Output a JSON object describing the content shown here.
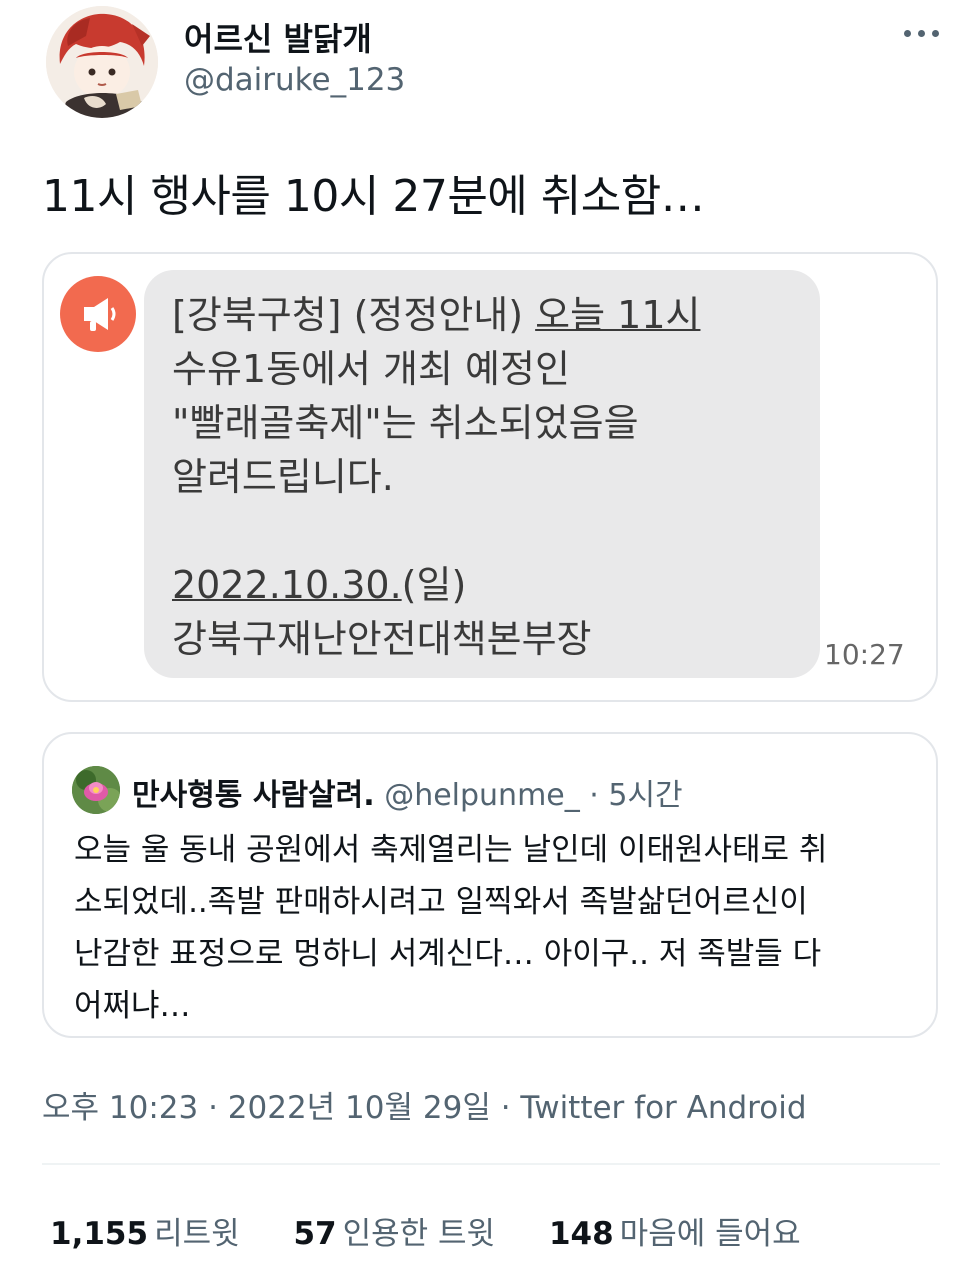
{
  "author": {
    "display_name": "어르신 발닭개",
    "handle": "@dairuke_123"
  },
  "tweet": {
    "text": "11시 행사를 10시 27분에 취소함…",
    "meta": "오후 10:23 · 2022년 10월 29일 · Twitter for Android"
  },
  "sms": {
    "line1_pre": "[강북구청] (정정안내) ",
    "line1_link": "오늘 11시",
    "line2": "수유1동에서 개최 예정인",
    "line3": "\"빨래골축제\"는 취소되었음을",
    "line4": "알려드립니다.",
    "date_link": "2022.10.30.",
    "date_rest": "(일)",
    "line6": "강북구재난안전대책본부장",
    "time": "10:27"
  },
  "quote": {
    "name": "만사형통 사람살려.",
    "handle": "@helpunme_",
    "time": " · 5시간",
    "lines": [
      "오늘 울 동내 공원에서 축제열리는 날인데 이태원사태로 취",
      "소되었데..족발 판매하시려고 일찍와서 족발삶던어르신이",
      "난감한 표정으로 멍하니 서계신다… 아이구.. 저 족발들 다",
      "어쩌냐…"
    ]
  },
  "stats": {
    "retweets_count": "1,155",
    "retweets_label": "리트윗",
    "quotes_count": "57",
    "quotes_label": "인용한 트윗",
    "likes_count": "148",
    "likes_label": "마음에 들어요"
  }
}
